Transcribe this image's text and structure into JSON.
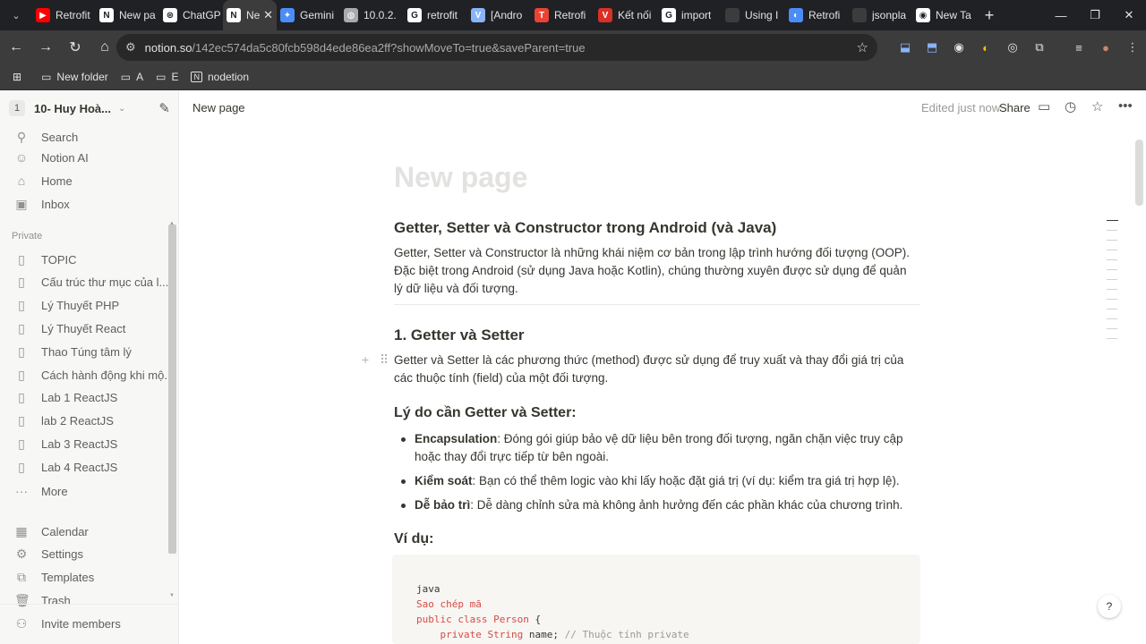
{
  "browser": {
    "tabs": [
      {
        "label": "Retrofit",
        "color": "#ff0000",
        "glyph": "▶"
      },
      {
        "label": "New pa",
        "color": "#ffffff",
        "glyph": "N"
      },
      {
        "label": "ChatGP",
        "color": "#ffffff",
        "glyph": "⊛"
      },
      {
        "label": "Ne",
        "color": "#ffffff",
        "glyph": "N",
        "active": true
      },
      {
        "label": "Gemini",
        "color": "#4b8df8",
        "glyph": "✦"
      },
      {
        "label": "10.0.2.",
        "color": "#aaaaaa",
        "glyph": "◍"
      },
      {
        "label": "retrofit",
        "color": "#ffffff",
        "glyph": "G"
      },
      {
        "label": "[Andro",
        "color": "#8ab4f8",
        "glyph": "V"
      },
      {
        "label": "Retrofi",
        "color": "#ea4335",
        "glyph": "T"
      },
      {
        "label": "Kết nối",
        "color": "#d93025",
        "glyph": "V"
      },
      {
        "label": "import",
        "color": "#ffffff",
        "glyph": "G"
      },
      {
        "label": "Using I",
        "color": "#3c3c3c",
        "glyph": ""
      },
      {
        "label": "Retrofi",
        "color": "#4b8df8",
        "glyph": "◐"
      },
      {
        "label": "jsonpla",
        "color": "#3c3c3c",
        "glyph": ""
      },
      {
        "label": "New Ta",
        "color": "#ffffff",
        "glyph": "◉"
      }
    ],
    "url_host": "notion.so",
    "url_rest": "/142ec574da5c80fcb598d4ede86ea2ff?showMoveTo=true&saveParent=true",
    "bookmarks": [
      "New folder",
      "A",
      "E",
      "nodetion"
    ]
  },
  "sidebar": {
    "workspace": "10- Huy Hoà...",
    "workspace_icon": "1",
    "top_items": [
      {
        "label": "Search",
        "icon": "search-icon"
      },
      {
        "label": "Notion AI",
        "icon": "notion-ai-icon"
      },
      {
        "label": "Home",
        "icon": "home-icon"
      },
      {
        "label": "Inbox",
        "icon": "inbox-icon"
      }
    ],
    "private_label": "Private",
    "pages": [
      "TOPIC",
      "Cấu trúc thư mục của l...",
      "Lý Thuyết PHP",
      "Lý Thuyết React",
      "Thao Túng tâm lý",
      "Cách hành động khi mộ...",
      "Lab 1 ReactJS",
      "lab 2 ReactJS",
      "Lab 3 ReactJS",
      "Lab 4 ReactJS"
    ],
    "more": "More",
    "bottom_items": [
      {
        "label": "Calendar",
        "icon": "calendar-icon"
      },
      {
        "label": "Settings",
        "icon": "gear-icon"
      },
      {
        "label": "Templates",
        "icon": "templates-icon"
      },
      {
        "label": "Trash",
        "icon": "trash-icon"
      }
    ],
    "invite": "Invite members"
  },
  "topbar": {
    "breadcrumb": "New page",
    "edited": "Edited just now",
    "share": "Share"
  },
  "page": {
    "title": "New page",
    "h_main": "Getter, Setter và Constructor trong Android (và Java)",
    "intro": "Getter, Setter và Constructor là những khái niệm cơ bản trong lập trình hướng đối tượng (OOP). Đặc biệt trong Android (sử dụng Java hoặc Kotlin), chúng thường xuyên được sử dụng để quản lý dữ liệu và đối tượng.",
    "h_section1": "1. Getter và Setter",
    "section1_text": "Getter và Setter là các phương thức (method) được sử dụng để truy xuất và thay đổi giá trị của các thuộc tính (field) của một đối tượng.",
    "h_why": "Lý do cần Getter và Setter:",
    "bullets": [
      {
        "term": "Encapsulation",
        "text": ": Đóng gói giúp bảo vệ dữ liệu bên trong đối tượng, ngăn chặn việc truy cập hoặc thay đổi trực tiếp từ bên ngoài."
      },
      {
        "term": "Kiểm soát",
        "text": ": Bạn có thể thêm logic vào khi lấy hoặc đặt giá trị (ví dụ: kiểm tra giá trị hợp lệ)."
      },
      {
        "term": "Dễ bảo trì",
        "text": ": Dễ dàng chỉnh sửa mà không ảnh hưởng đến các phần khác của chương trình."
      }
    ],
    "h_example": "Ví dụ:",
    "code_lang": "java",
    "code_copy": "Sao chép mã",
    "code_line1_kw": "public class",
    "code_line1_name": "Person",
    "code_line1_rest": " {",
    "code_line2_kw": "private",
    "code_line2_type": "String",
    "code_line2_var": " name;",
    "code_line2_comment": " // Thuộc tính private"
  }
}
